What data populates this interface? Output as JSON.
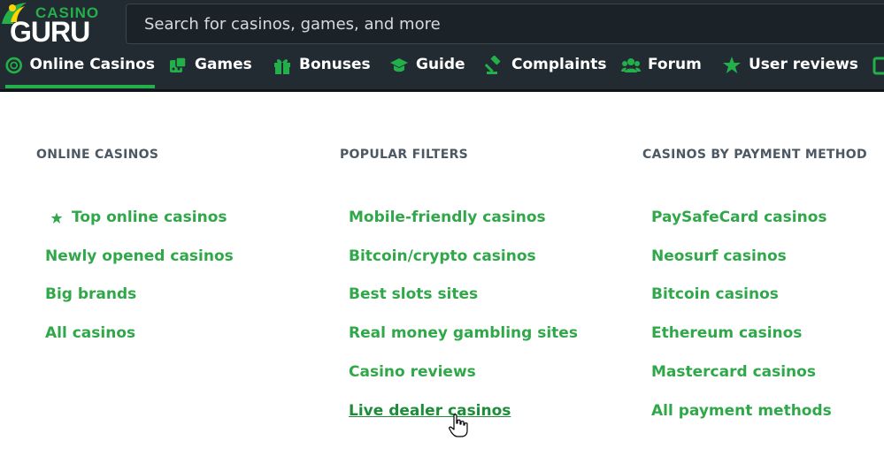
{
  "logo": {
    "top": "CASINO",
    "bottom": "GURU"
  },
  "search": {
    "placeholder": "Search for casinos, games, and more"
  },
  "nav": [
    {
      "label": "Online Casinos",
      "icon": "chip-icon",
      "active": true
    },
    {
      "label": "Games",
      "icon": "dice-icon"
    },
    {
      "label": "Bonuses",
      "icon": "gift-icon"
    },
    {
      "label": "Guide",
      "icon": "graduation-cap-icon"
    },
    {
      "label": "Complaints",
      "icon": "gavel-icon"
    },
    {
      "label": "Forum",
      "icon": "users-icon"
    },
    {
      "label": "User reviews",
      "icon": "star-icon"
    }
  ],
  "columns": [
    {
      "heading": "ONLINE CASINOS",
      "links": [
        "Top online casinos",
        "Newly opened casinos",
        "Big brands",
        "All casinos"
      ]
    },
    {
      "heading": "POPULAR FILTERS",
      "links": [
        "Mobile-friendly casinos",
        "Bitcoin/crypto casinos",
        "Best slots sites",
        "Real money gambling sites",
        "Casino reviews",
        "Live dealer casinos"
      ]
    },
    {
      "heading": "CASINOS BY PAYMENT METHOD",
      "links": [
        "PaySafeCard casinos",
        "Neosurf casinos",
        "Bitcoin casinos",
        "Ethereum casinos",
        "Mastercard casinos",
        "All payment methods"
      ]
    }
  ],
  "colors": {
    "header_bg": "#222b32",
    "accent": "#23b04a",
    "link": "#30a84a",
    "heading": "#4c5863"
  }
}
